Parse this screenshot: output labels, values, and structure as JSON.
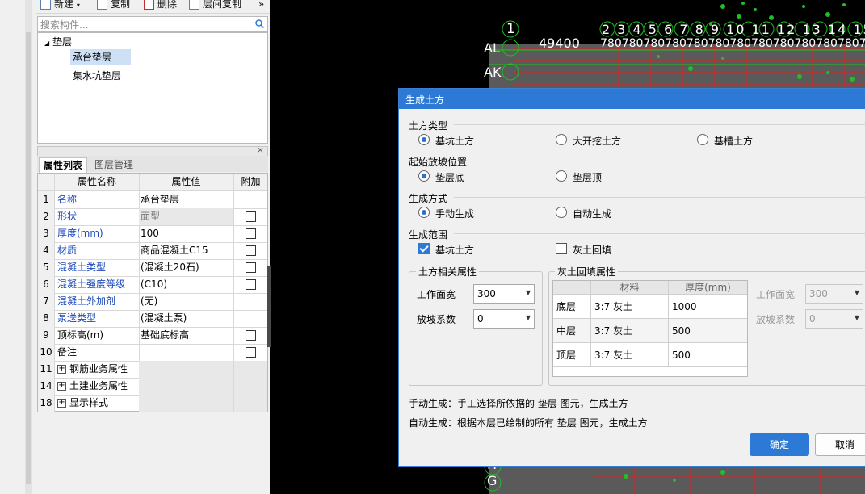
{
  "toolbar": {
    "new_label": "新建",
    "copy_label": "复制",
    "delete_label": "删除",
    "floor_copy_label": "层间复制",
    "more_label": "»"
  },
  "search": {
    "placeholder": "搜索构件..."
  },
  "tree": {
    "root_label": "垫层",
    "items": [
      {
        "label": "承台垫层",
        "selected": true
      },
      {
        "label": "集水坑垫层",
        "selected": false
      }
    ]
  },
  "props": {
    "tab_active": "属性列表",
    "tab_inactive": "图层管理",
    "headers": {
      "name": "属性名称",
      "value": "属性值",
      "add": "附加"
    },
    "rows": [
      {
        "idx": "1",
        "name": "名称",
        "value": "承台垫层",
        "blue": true,
        "check": false
      },
      {
        "idx": "2",
        "name": "形状",
        "value": "面型",
        "blue": true,
        "check": true,
        "gray": true
      },
      {
        "idx": "3",
        "name": "厚度(mm)",
        "value": "100",
        "blue": true,
        "check": true
      },
      {
        "idx": "4",
        "name": "材质",
        "value": "商品混凝土C15",
        "blue": true,
        "check": true
      },
      {
        "idx": "5",
        "name": "混凝土类型",
        "value": "(混凝土20石)",
        "blue": true,
        "check": true
      },
      {
        "idx": "6",
        "name": "混凝土强度等级",
        "value": "(C10)",
        "blue": true,
        "check": true
      },
      {
        "idx": "7",
        "name": "混凝土外加剂",
        "value": "(无)",
        "blue": true,
        "check": false
      },
      {
        "idx": "8",
        "name": "泵送类型",
        "value": "(混凝土泵)",
        "blue": true,
        "check": false
      },
      {
        "idx": "9",
        "name": "顶标高(m)",
        "value": "基础底标高",
        "blue": false,
        "check": true
      },
      {
        "idx": "10",
        "name": "备注",
        "value": "",
        "blue": false,
        "check": true
      },
      {
        "idx": "11",
        "name": "钢筋业务属性",
        "value": "",
        "blue": false,
        "check": false,
        "group": true
      },
      {
        "idx": "14",
        "name": "土建业务属性",
        "value": "",
        "blue": false,
        "check": false,
        "group": true
      },
      {
        "idx": "18",
        "name": "显示样式",
        "value": "",
        "blue": false,
        "check": false,
        "group": true
      }
    ]
  },
  "cad": {
    "axis_numbers": [
      "1",
      "2",
      "3",
      "4",
      "5",
      "6",
      "7",
      "8",
      "9",
      "10",
      "11",
      "12",
      "13",
      "14",
      "15",
      "16",
      "17",
      "18"
    ],
    "labels": [
      "AL",
      "AK",
      "49400",
      "H",
      "G"
    ],
    "dim_row": "780780780780780780780780780780780780780780780",
    "rotated": "1 0870"
  },
  "dialog": {
    "title": "生成土方",
    "earth_type": {
      "label": "土方类型",
      "options": [
        "基坑土方",
        "大开挖土方",
        "基槽土方"
      ],
      "selected": 0
    },
    "slope_pos": {
      "label": "起始放坡位置",
      "options": [
        "垫层底",
        "垫层顶"
      ],
      "selected": 0
    },
    "gen_mode": {
      "label": "生成方式",
      "options": [
        "手动生成",
        "自动生成"
      ],
      "selected": 0
    },
    "gen_range": {
      "label": "生成范围",
      "options": [
        {
          "label": "基坑土方",
          "checked": true
        },
        {
          "label": "灰土回填",
          "checked": false
        }
      ]
    },
    "earth_attrs": {
      "title": "土方相关属性",
      "work_width_label": "工作面宽",
      "work_width": "300",
      "slope_label": "放坡系数",
      "slope": "0"
    },
    "fill_attrs": {
      "title": "灰土回填属性",
      "col_material": "材料",
      "col_thickness": "厚度(mm)",
      "rows": [
        {
          "layer": "底层",
          "material": "3:7 灰土",
          "thickness": "1000"
        },
        {
          "layer": "中层",
          "material": "3:7 灰土",
          "thickness": "500"
        },
        {
          "layer": "顶层",
          "material": "3:7 灰土",
          "thickness": "500"
        }
      ],
      "work_width_label": "工作面宽",
      "work_width": "300",
      "slope_label": "放坡系数",
      "slope": "0"
    },
    "note1": "手动生成：手工选择所依据的 垫层 图元，生成土方",
    "note2": "自动生成：根据本层已绘制的所有 垫层 图元，生成土方",
    "ok_label": "确定",
    "cancel_label": "取消"
  },
  "colors": {
    "accent": "#2d7ad6",
    "cad_red": "#e02020",
    "cad_green": "#20c020",
    "cad_fill": "#6a6a6a"
  }
}
